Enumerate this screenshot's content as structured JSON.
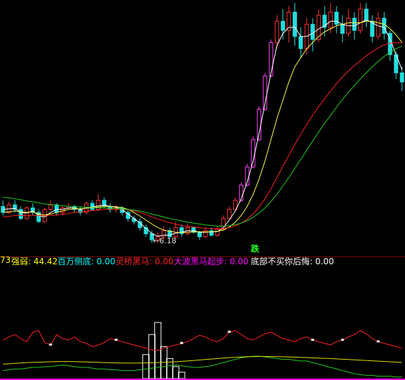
{
  "chart_data": {
    "type": "candlestick",
    "main_panel": {
      "low_label": "6.18",
      "signal_label": "跌",
      "candles": [
        [
          0,
          7.4,
          7.2,
          7.6,
          7.1
        ],
        [
          1,
          7.2,
          7.45,
          7.55,
          7.15
        ],
        [
          2,
          7.45,
          7.3,
          7.6,
          7.2
        ],
        [
          3,
          7.3,
          7.0,
          7.4,
          6.95
        ],
        [
          4,
          7.0,
          7.35,
          7.4,
          6.95
        ],
        [
          5,
          7.35,
          7.2,
          7.5,
          7.1
        ],
        [
          6,
          7.2,
          6.9,
          7.3,
          6.85
        ],
        [
          7,
          6.9,
          7.3,
          7.35,
          6.85
        ],
        [
          8,
          7.3,
          7.45,
          7.6,
          7.25
        ],
        [
          9,
          7.45,
          7.2,
          7.5,
          7.1
        ],
        [
          10,
          7.2,
          7.35,
          7.4,
          7.1
        ],
        [
          11,
          7.35,
          7.4,
          7.5,
          7.3
        ],
        [
          12,
          7.4,
          7.3,
          7.45,
          7.2
        ],
        [
          13,
          7.3,
          7.2,
          7.4,
          7.1
        ],
        [
          14,
          7.2,
          7.5,
          7.55,
          7.15
        ],
        [
          15,
          7.5,
          7.3,
          7.6,
          7.25
        ],
        [
          16,
          7.3,
          7.6,
          7.8,
          7.25
        ],
        [
          17,
          7.6,
          7.4,
          7.7,
          7.35
        ],
        [
          18,
          7.4,
          7.3,
          7.5,
          7.2
        ],
        [
          19,
          7.3,
          7.35,
          7.45,
          7.2
        ],
        [
          20,
          7.35,
          7.2,
          7.4,
          7.1
        ],
        [
          21,
          7.2,
          7.0,
          7.3,
          6.9
        ],
        [
          22,
          7.0,
          6.9,
          7.1,
          6.8
        ],
        [
          23,
          6.9,
          6.7,
          7.0,
          6.6
        ],
        [
          24,
          6.7,
          6.5,
          6.8,
          6.4
        ],
        [
          25,
          6.5,
          6.3,
          6.6,
          6.2
        ],
        [
          26,
          6.3,
          6.4,
          6.55,
          6.18
        ],
        [
          27,
          6.4,
          6.6,
          6.75,
          6.3
        ],
        [
          28,
          6.6,
          6.4,
          6.7,
          6.35
        ],
        [
          29,
          6.4,
          6.7,
          6.9,
          6.35
        ],
        [
          30,
          6.7,
          6.5,
          6.8,
          6.4
        ],
        [
          31,
          6.5,
          6.7,
          6.85,
          6.45
        ],
        [
          32,
          6.7,
          6.55,
          6.75,
          6.5
        ],
        [
          33,
          6.55,
          6.4,
          6.6,
          6.3
        ],
        [
          34,
          6.4,
          6.6,
          6.7,
          6.35
        ],
        [
          35,
          6.6,
          6.45,
          6.7,
          6.4
        ],
        [
          36,
          6.45,
          6.65,
          6.75,
          6.4
        ],
        [
          37,
          6.65,
          7.0,
          7.1,
          6.6
        ],
        [
          38,
          7.0,
          7.3,
          7.4,
          6.95
        ],
        [
          39,
          7.3,
          7.6,
          7.7,
          7.25
        ],
        [
          40,
          7.6,
          8.1,
          8.2,
          7.55
        ],
        [
          41,
          8.1,
          8.7,
          8.8,
          8.05
        ],
        [
          42,
          8.7,
          9.6,
          9.7,
          8.65
        ],
        [
          43,
          9.6,
          10.6,
          10.7,
          9.55
        ],
        [
          44,
          10.6,
          11.7,
          11.8,
          10.55
        ],
        [
          45,
          11.7,
          12.8,
          12.9,
          11.65
        ],
        [
          46,
          12.8,
          13.5,
          13.7,
          12.6
        ],
        [
          47,
          13.5,
          13.2,
          13.9,
          12.9
        ],
        [
          48,
          13.2,
          13.8,
          14.0,
          12.8
        ],
        [
          49,
          13.8,
          13.0,
          14.1,
          12.7
        ],
        [
          50,
          13.0,
          12.6,
          13.3,
          12.3
        ],
        [
          51,
          12.6,
          13.4,
          13.6,
          12.4
        ],
        [
          52,
          13.4,
          12.9,
          13.6,
          12.5
        ],
        [
          53,
          12.9,
          13.7,
          13.9,
          12.8
        ],
        [
          54,
          13.7,
          13.3,
          14.0,
          13.0
        ],
        [
          55,
          13.3,
          13.8,
          14.1,
          13.1
        ],
        [
          56,
          13.8,
          13.4,
          14.0,
          13.1
        ],
        [
          57,
          13.4,
          13.1,
          13.7,
          12.8
        ],
        [
          58,
          13.1,
          13.6,
          13.9,
          13.0
        ],
        [
          59,
          13.6,
          13.2,
          13.8,
          12.9
        ],
        [
          60,
          13.2,
          13.9,
          14.1,
          13.1
        ],
        [
          61,
          13.9,
          13.5,
          14.1,
          13.3
        ],
        [
          62,
          13.5,
          13.0,
          13.7,
          12.8
        ],
        [
          63,
          13.0,
          13.6,
          13.8,
          12.9
        ],
        [
          64,
          13.6,
          13.1,
          13.8,
          12.9
        ],
        [
          65,
          13.1,
          12.4,
          13.2,
          12.2
        ],
        [
          66,
          12.4,
          11.8,
          12.5,
          11.6
        ],
        [
          67,
          11.8,
          11.5,
          12.0,
          11.2
        ]
      ],
      "ma_series": [
        {
          "color": "#ffffff",
          "values": [
            7.3,
            7.32,
            7.33,
            7.2,
            7.18,
            7.25,
            7.1,
            7.05,
            7.2,
            7.3,
            7.3,
            7.35,
            7.35,
            7.3,
            7.35,
            7.38,
            7.42,
            7.44,
            7.4,
            7.37,
            7.3,
            7.15,
            7.0,
            6.85,
            6.68,
            6.5,
            6.42,
            6.45,
            6.46,
            6.52,
            6.55,
            6.6,
            6.6,
            6.55,
            6.55,
            6.56,
            6.57,
            6.7,
            6.95,
            7.25,
            7.65,
            8.2,
            8.9,
            9.8,
            10.8,
            11.8,
            12.7,
            13.1,
            13.3,
            13.3,
            13.0,
            13.0,
            13.1,
            13.25,
            13.35,
            13.5,
            13.5,
            13.4,
            13.35,
            13.35,
            13.45,
            13.55,
            13.45,
            13.35,
            13.3,
            12.9,
            12.4,
            11.9
          ]
        },
        {
          "color": "#ffff44",
          "values": [
            7.2,
            7.22,
            7.25,
            7.22,
            7.2,
            7.22,
            7.15,
            7.12,
            7.15,
            7.2,
            7.25,
            7.3,
            7.32,
            7.32,
            7.34,
            7.36,
            7.38,
            7.4,
            7.4,
            7.39,
            7.36,
            7.3,
            7.2,
            7.08,
            6.95,
            6.82,
            6.7,
            6.62,
            6.58,
            6.55,
            6.54,
            6.55,
            6.56,
            6.56,
            6.56,
            6.56,
            6.58,
            6.62,
            6.72,
            6.88,
            7.1,
            7.4,
            7.8,
            8.3,
            8.9,
            9.6,
            10.3,
            10.9,
            11.5,
            12.0,
            12.3,
            12.6,
            12.8,
            13.0,
            13.15,
            13.25,
            13.35,
            13.4,
            13.45,
            13.45,
            13.45,
            13.5,
            13.5,
            13.45,
            13.4,
            13.25,
            13.05,
            12.8
          ]
        },
        {
          "color": "#ff2222",
          "values": [
            7.05,
            7.07,
            7.1,
            7.1,
            7.1,
            7.11,
            7.1,
            7.09,
            7.1,
            7.12,
            7.14,
            7.17,
            7.2,
            7.22,
            7.24,
            7.26,
            7.28,
            7.3,
            7.31,
            7.31,
            7.31,
            7.29,
            7.25,
            7.2,
            7.13,
            7.05,
            6.98,
            6.92,
            6.86,
            6.81,
            6.77,
            6.74,
            6.72,
            6.7,
            6.68,
            6.67,
            6.66,
            6.67,
            6.7,
            6.76,
            6.85,
            6.98,
            7.15,
            7.38,
            7.65,
            7.98,
            8.35,
            8.72,
            9.08,
            9.44,
            9.78,
            10.1,
            10.4,
            10.68,
            10.95,
            11.2,
            11.45,
            11.66,
            11.86,
            12.04,
            12.2,
            12.36,
            12.5,
            12.62,
            12.72,
            12.78,
            12.8,
            12.78
          ]
        },
        {
          "color": "#22cc22",
          "values": [
            7.7,
            7.68,
            7.65,
            7.62,
            7.58,
            7.55,
            7.52,
            7.48,
            7.46,
            7.44,
            7.42,
            7.4,
            7.39,
            7.38,
            7.37,
            7.36,
            7.35,
            7.35,
            7.34,
            7.33,
            7.32,
            7.3,
            7.28,
            7.25,
            7.2,
            7.15,
            7.1,
            7.05,
            7.0,
            6.96,
            6.92,
            6.88,
            6.85,
            6.82,
            6.79,
            6.77,
            6.75,
            6.75,
            6.76,
            6.8,
            6.85,
            6.93,
            7.04,
            7.18,
            7.35,
            7.56,
            7.8,
            8.07,
            8.35,
            8.65,
            8.95,
            9.25,
            9.55,
            9.85,
            10.13,
            10.4,
            10.67,
            10.92,
            11.16,
            11.38,
            11.6,
            11.8,
            12.0,
            12.18,
            12.34,
            12.48,
            12.6,
            12.68
          ]
        }
      ]
    },
    "indicator_panel": {
      "prefix": "73",
      "items": [
        {
          "label": "强弱",
          "value": "44.42",
          "color": "#ffff00"
        },
        {
          "label": "百万侧底",
          "value": "0.00",
          "color": "#00ffff"
        },
        {
          "label": "灵桥黑马",
          "value": "0.00",
          "color": "#ff2222"
        },
        {
          "label": "大波黑马起步",
          "value": "0.00",
          "color": "#ff00ff"
        },
        {
          "label": "底部不买你后悔",
          "value": "0.00",
          "color": "#ffffff"
        }
      ],
      "red_line": [
        48,
        52,
        55,
        50,
        46,
        58,
        60,
        45,
        42,
        55,
        50,
        48,
        52,
        46,
        44,
        40,
        42,
        45,
        50,
        48,
        46,
        44,
        42,
        40,
        38,
        36,
        35,
        38,
        40,
        42,
        44,
        46,
        50,
        54,
        52,
        48,
        46,
        50,
        58,
        60,
        55,
        50,
        48,
        52,
        56,
        58,
        54,
        50,
        48,
        46,
        50,
        52,
        48,
        46,
        44,
        42,
        46,
        48,
        52,
        55,
        60,
        56,
        50,
        46,
        44,
        42,
        40,
        38
      ],
      "green_line": [
        10,
        11,
        12,
        12,
        13,
        14,
        14,
        15,
        15,
        16,
        17,
        16,
        15,
        14,
        14,
        13,
        12,
        12,
        11,
        11,
        10,
        10,
        10,
        11,
        12,
        13,
        14,
        15,
        16,
        17,
        16,
        15,
        14,
        14,
        15,
        16,
        18,
        20,
        22,
        24,
        26,
        27,
        28,
        28,
        27,
        26,
        25,
        24,
        24,
        23,
        22,
        22,
        20,
        18,
        16,
        14,
        12,
        10,
        8,
        6,
        5,
        4,
        4,
        3,
        3,
        3,
        2,
        2
      ],
      "yellow_line": [
        18,
        18.5,
        19,
        19.5,
        20,
        20.2,
        20.5,
        20.8,
        21,
        21.2,
        21.3,
        21.3,
        21.2,
        21,
        20.8,
        20.5,
        20.2,
        20,
        19.8,
        19.6,
        19.5,
        19.4,
        19.4,
        19.5,
        19.6,
        19.8,
        20,
        20.3,
        20.6,
        21,
        21.5,
        22,
        22.6,
        23.2,
        23.8,
        24.4,
        25,
        25.6,
        26.1,
        26.6,
        27,
        27.3,
        27.5,
        27.6,
        27.6,
        27.5,
        27.4,
        27.2,
        27,
        26.8,
        26.5,
        26.2,
        25.9,
        25.6,
        25.3,
        25,
        24.6,
        24.2,
        23.8,
        23.4,
        23,
        22.6,
        22.2,
        21.8,
        21.4,
        21,
        20.6,
        20.2
      ],
      "bars": [
        0,
        0,
        0,
        0,
        0,
        0,
        0,
        0,
        0,
        0,
        0,
        0,
        0,
        0,
        0,
        0,
        0,
        0,
        0,
        0,
        0,
        0,
        0,
        0,
        0,
        0,
        0,
        0,
        0,
        0,
        0,
        0,
        0,
        0,
        0,
        0,
        0,
        0,
        0,
        0,
        0,
        0,
        0,
        0,
        0,
        0,
        0,
        0,
        0,
        0,
        0,
        0,
        0,
        0,
        0,
        0,
        0,
        0,
        0,
        0,
        0,
        0,
        0,
        0,
        0,
        0,
        0,
        0
      ],
      "spike_bars": [
        {
          "i": 24,
          "v": 30
        },
        {
          "i": 25,
          "v": 55
        },
        {
          "i": 26,
          "v": 70
        },
        {
          "i": 27,
          "v": 40
        },
        {
          "i": 28,
          "v": 25
        },
        {
          "i": 29,
          "v": 15
        },
        {
          "i": 30,
          "v": 8
        }
      ]
    }
  }
}
